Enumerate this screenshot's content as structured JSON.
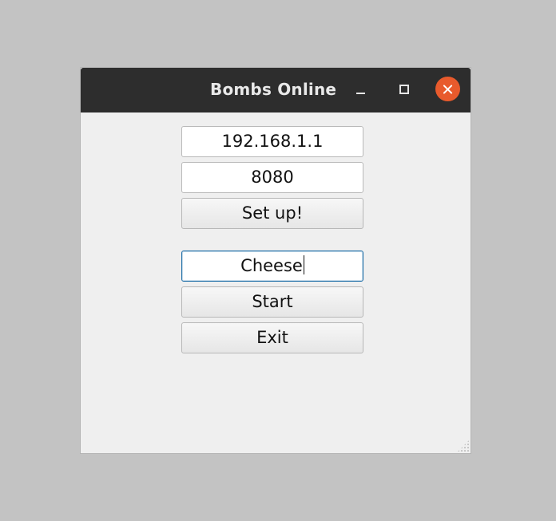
{
  "window": {
    "title": "Bombs Online"
  },
  "form": {
    "ip_value": "192.168.1.1",
    "port_value": "8080",
    "setup_label": "Set up!",
    "name_value": "Cheese",
    "start_label": "Start",
    "exit_label": "Exit"
  },
  "colors": {
    "titlebar": "#2d2d2d",
    "close_button": "#e85a2c",
    "focus_border": "#1f6fa8",
    "window_background": "#efefef",
    "desktop_background": "#c3c3c3"
  },
  "icons": {
    "minimize": "minimize-icon",
    "maximize": "maximize-icon",
    "close": "close-icon",
    "resize": "resize-grip-icon"
  }
}
